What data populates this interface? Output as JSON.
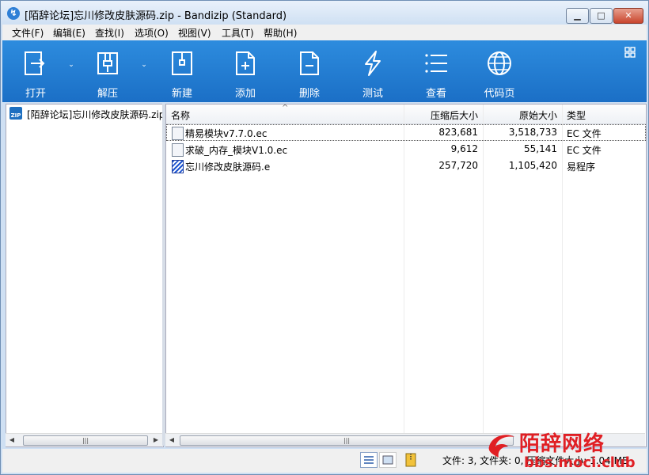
{
  "window": {
    "title": "[陌辞论坛]忘川修改皮肤源码.zip - Bandizip (Standard)",
    "min_glyph": "▁",
    "max_glyph": "□",
    "close_glyph": "✕"
  },
  "menubar": {
    "items": [
      "文件(F)",
      "编辑(E)",
      "查找(I)",
      "选项(O)",
      "视图(V)",
      "工具(T)",
      "帮助(H)"
    ]
  },
  "toolbar": {
    "buttons": [
      {
        "label": "打开",
        "icon": "open-icon"
      },
      {
        "label": "解压",
        "icon": "extract-icon"
      },
      {
        "label": "新建",
        "icon": "new-archive-icon"
      },
      {
        "label": "添加",
        "icon": "add-file-icon"
      },
      {
        "label": "删除",
        "icon": "delete-file-icon"
      },
      {
        "label": "测试",
        "icon": "test-lightning-icon"
      },
      {
        "label": "查看",
        "icon": "view-list-icon"
      },
      {
        "label": "代码页",
        "icon": "globe-icon"
      }
    ],
    "dropdown_glyph": "⌄",
    "background": "#1f7bd3"
  },
  "tree": {
    "root": "[陌辞论坛]忘川修改皮肤源码.zip"
  },
  "file_list": {
    "columns": [
      "名称",
      "压缩后大小",
      "原始大小",
      "类型"
    ],
    "sort_glyph": "^",
    "rows": [
      {
        "name": "精易模块v7.7.0.ec",
        "packed": "823,681",
        "size": "3,518,733",
        "type": "EC 文件",
        "icon": "ec-file-icon"
      },
      {
        "name": "求破_内存_模块V1.0.ec",
        "packed": "9,612",
        "size": "55,141",
        "type": "EC 文件",
        "icon": "ec-file-icon"
      },
      {
        "name": "忘川修改皮肤源码.e",
        "packed": "257,720",
        "size": "1,105,420",
        "type": "易程序",
        "icon": "e-program-icon"
      }
    ]
  },
  "scroll": {
    "left_arrow": "◀",
    "right_arrow": "▶",
    "thumb_grip": "|||"
  },
  "status": {
    "text": "文件: 3, 文件夹: 0, 压缩文件大小: 1.04 MB"
  },
  "watermark": {
    "title": "陌辞网络",
    "url": "bbs.moci.club",
    "color": "#e01f24"
  }
}
